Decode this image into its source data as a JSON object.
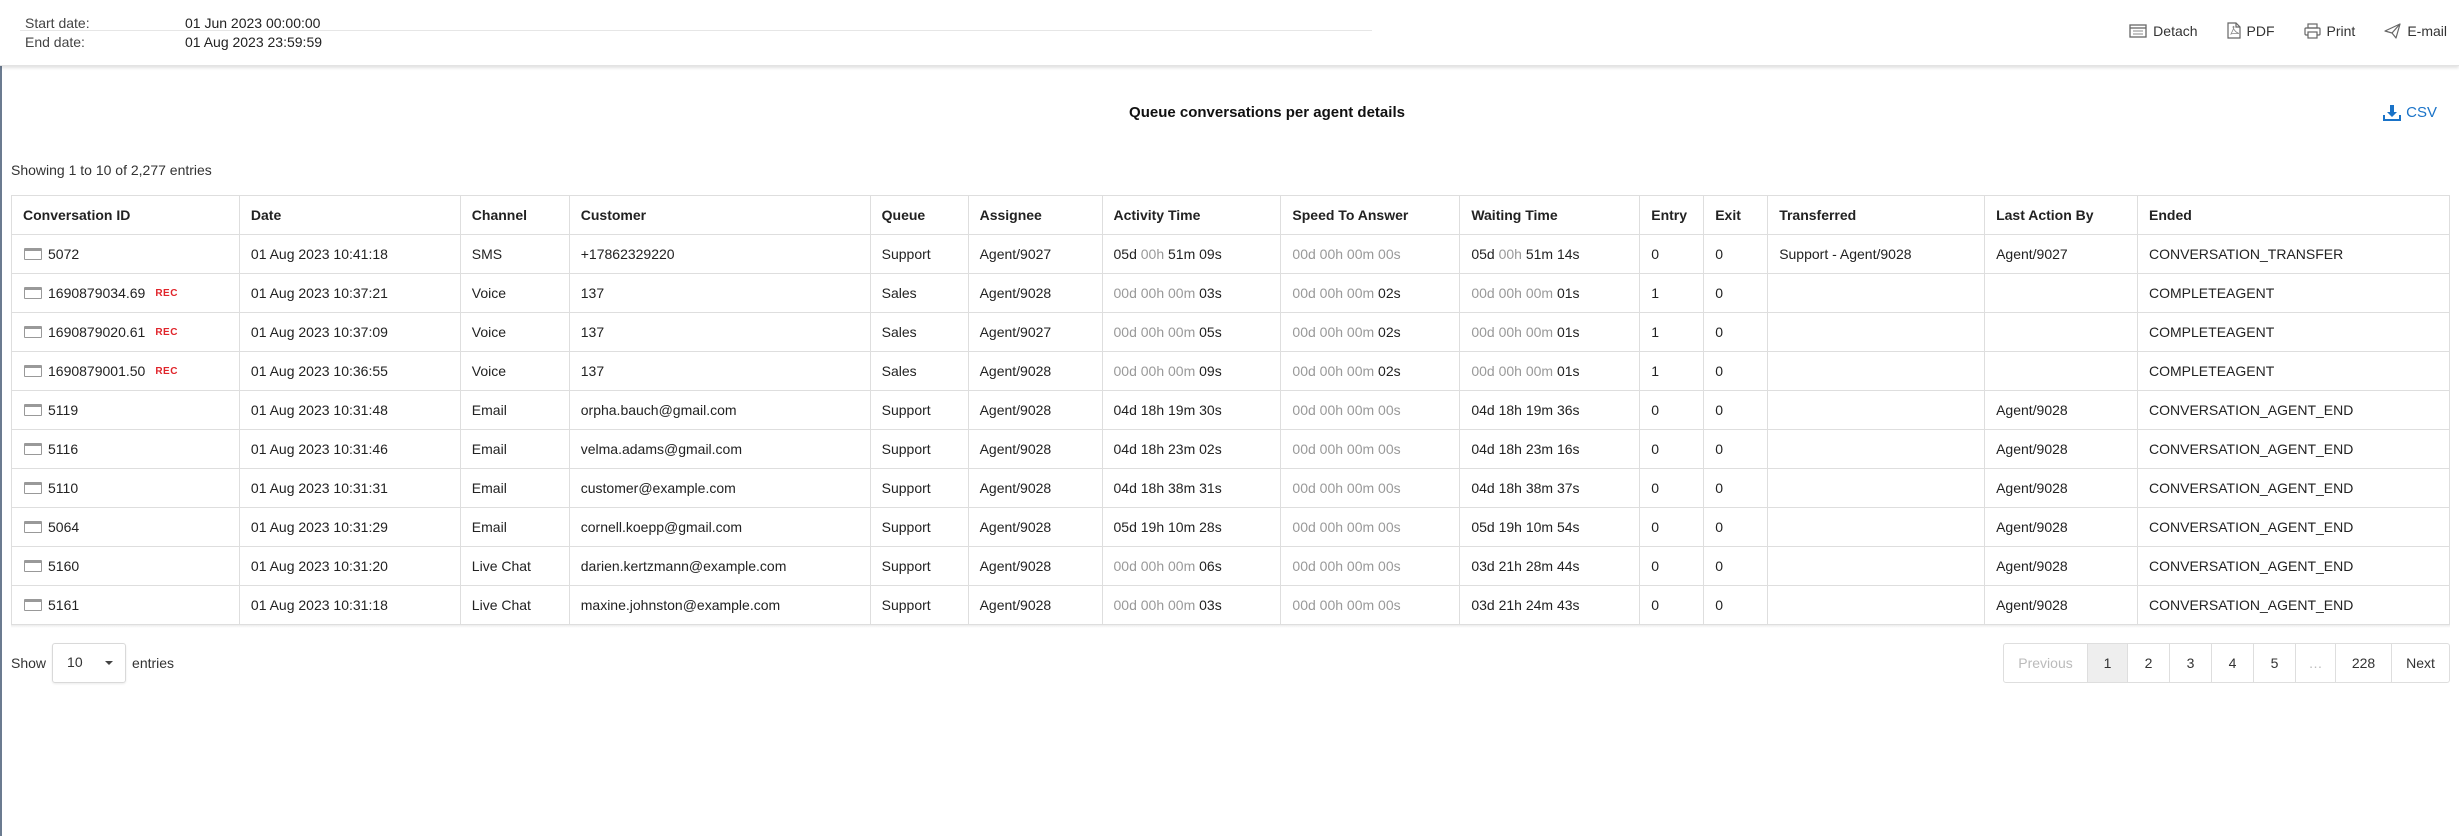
{
  "header": {
    "start_label": "Start date:",
    "start_value": "01 Jun 2023 00:00:00",
    "end_label": "End date:",
    "end_value": "01 Aug 2023 23:59:59"
  },
  "toolbar": {
    "detach": "Detach",
    "pdf": "PDF",
    "print": "Print",
    "email": "E-mail"
  },
  "report": {
    "title": "Queue conversations per agent details",
    "csv_label": "CSV",
    "showing": "Showing 1 to 10 of 2,277 entries"
  },
  "table": {
    "headers": [
      "Conversation ID",
      "Date",
      "Channel",
      "Customer",
      "Queue",
      "Assignee",
      "Activity Time",
      "Speed To Answer",
      "Waiting Time",
      "Entry",
      "Exit",
      "Transferred",
      "Last Action By",
      "Ended"
    ],
    "rows": [
      {
        "id": "5072",
        "rec": "",
        "date": "01 Aug 2023 10:41:18",
        "channel": "SMS",
        "customer": "+17862329220",
        "queue": "Support",
        "assignee": "Agent/9027",
        "activity": [
          {
            "t": "05d ",
            "d": false
          },
          {
            "t": "00h ",
            "d": true
          },
          {
            "t": "51m 09s",
            "d": false
          }
        ],
        "speed": [
          {
            "t": "00d 00h 00m 00s",
            "d": true
          }
        ],
        "waiting": [
          {
            "t": "05d ",
            "d": false
          },
          {
            "t": "00h ",
            "d": true
          },
          {
            "t": "51m 14s",
            "d": false
          }
        ],
        "entry": "0",
        "exit": "0",
        "transferred": "Support - Agent/9028",
        "last_action": "Agent/9027",
        "ended": "CONVERSATION_TRANSFER"
      },
      {
        "id": "1690879034.69",
        "rec": "REC",
        "date": "01 Aug 2023 10:37:21",
        "channel": "Voice",
        "customer": "137",
        "queue": "Sales",
        "assignee": "Agent/9028",
        "activity": [
          {
            "t": "00d 00h 00m ",
            "d": true
          },
          {
            "t": "03s",
            "d": false
          }
        ],
        "speed": [
          {
            "t": "00d 00h 00m ",
            "d": true
          },
          {
            "t": "02s",
            "d": false
          }
        ],
        "waiting": [
          {
            "t": "00d 00h 00m ",
            "d": true
          },
          {
            "t": "01s",
            "d": false
          }
        ],
        "entry": "1",
        "exit": "0",
        "transferred": "",
        "last_action": "",
        "ended": "COMPLETEAGENT"
      },
      {
        "id": "1690879020.61",
        "rec": "REC",
        "date": "01 Aug 2023 10:37:09",
        "channel": "Voice",
        "customer": "137",
        "queue": "Sales",
        "assignee": "Agent/9027",
        "activity": [
          {
            "t": "00d 00h 00m ",
            "d": true
          },
          {
            "t": "05s",
            "d": false
          }
        ],
        "speed": [
          {
            "t": "00d 00h 00m ",
            "d": true
          },
          {
            "t": "02s",
            "d": false
          }
        ],
        "waiting": [
          {
            "t": "00d 00h 00m ",
            "d": true
          },
          {
            "t": "01s",
            "d": false
          }
        ],
        "entry": "1",
        "exit": "0",
        "transferred": "",
        "last_action": "",
        "ended": "COMPLETEAGENT"
      },
      {
        "id": "1690879001.50",
        "rec": "REC",
        "date": "01 Aug 2023 10:36:55",
        "channel": "Voice",
        "customer": "137",
        "queue": "Sales",
        "assignee": "Agent/9028",
        "activity": [
          {
            "t": "00d 00h 00m ",
            "d": true
          },
          {
            "t": "09s",
            "d": false
          }
        ],
        "speed": [
          {
            "t": "00d 00h 00m ",
            "d": true
          },
          {
            "t": "02s",
            "d": false
          }
        ],
        "waiting": [
          {
            "t": "00d 00h 00m ",
            "d": true
          },
          {
            "t": "01s",
            "d": false
          }
        ],
        "entry": "1",
        "exit": "0",
        "transferred": "",
        "last_action": "",
        "ended": "COMPLETEAGENT"
      },
      {
        "id": "5119",
        "rec": "",
        "date": "01 Aug 2023 10:31:48",
        "channel": "Email",
        "customer": "orpha.bauch@gmail.com",
        "queue": "Support",
        "assignee": "Agent/9028",
        "activity": [
          {
            "t": "04d 18h 19m 30s",
            "d": false
          }
        ],
        "speed": [
          {
            "t": "00d 00h 00m 00s",
            "d": true
          }
        ],
        "waiting": [
          {
            "t": "04d 18h 19m 36s",
            "d": false
          }
        ],
        "entry": "0",
        "exit": "0",
        "transferred": "",
        "last_action": "Agent/9028",
        "ended": "CONVERSATION_AGENT_END"
      },
      {
        "id": "5116",
        "rec": "",
        "date": "01 Aug 2023 10:31:46",
        "channel": "Email",
        "customer": "velma.adams@gmail.com",
        "queue": "Support",
        "assignee": "Agent/9028",
        "activity": [
          {
            "t": "04d 18h 23m 02s",
            "d": false
          }
        ],
        "speed": [
          {
            "t": "00d 00h 00m 00s",
            "d": true
          }
        ],
        "waiting": [
          {
            "t": "04d 18h 23m 16s",
            "d": false
          }
        ],
        "entry": "0",
        "exit": "0",
        "transferred": "",
        "last_action": "Agent/9028",
        "ended": "CONVERSATION_AGENT_END"
      },
      {
        "id": "5110",
        "rec": "",
        "date": "01 Aug 2023 10:31:31",
        "channel": "Email",
        "customer": "customer@example.com",
        "queue": "Support",
        "assignee": "Agent/9028",
        "activity": [
          {
            "t": "04d 18h 38m 31s",
            "d": false
          }
        ],
        "speed": [
          {
            "t": "00d 00h 00m 00s",
            "d": true
          }
        ],
        "waiting": [
          {
            "t": "04d 18h 38m 37s",
            "d": false
          }
        ],
        "entry": "0",
        "exit": "0",
        "transferred": "",
        "last_action": "Agent/9028",
        "ended": "CONVERSATION_AGENT_END"
      },
      {
        "id": "5064",
        "rec": "",
        "date": "01 Aug 2023 10:31:29",
        "channel": "Email",
        "customer": "cornell.koepp@gmail.com",
        "queue": "Support",
        "assignee": "Agent/9028",
        "activity": [
          {
            "t": "05d 19h 10m 28s",
            "d": false
          }
        ],
        "speed": [
          {
            "t": "00d 00h 00m 00s",
            "d": true
          }
        ],
        "waiting": [
          {
            "t": "05d 19h 10m 54s",
            "d": false
          }
        ],
        "entry": "0",
        "exit": "0",
        "transferred": "",
        "last_action": "Agent/9028",
        "ended": "CONVERSATION_AGENT_END"
      },
      {
        "id": "5160",
        "rec": "",
        "date": "01 Aug 2023 10:31:20",
        "channel": "Live Chat",
        "customer": "darien.kertzmann@example.com",
        "queue": "Support",
        "assignee": "Agent/9028",
        "activity": [
          {
            "t": "00d 00h 00m ",
            "d": true
          },
          {
            "t": "06s",
            "d": false
          }
        ],
        "speed": [
          {
            "t": "00d 00h 00m 00s",
            "d": true
          }
        ],
        "waiting": [
          {
            "t": "03d 21h 28m 44s",
            "d": false
          }
        ],
        "entry": "0",
        "exit": "0",
        "transferred": "",
        "last_action": "Agent/9028",
        "ended": "CONVERSATION_AGENT_END"
      },
      {
        "id": "5161",
        "rec": "",
        "date": "01 Aug 2023 10:31:18",
        "channel": "Live Chat",
        "customer": "maxine.johnston@example.com",
        "queue": "Support",
        "assignee": "Agent/9028",
        "activity": [
          {
            "t": "00d 00h 00m ",
            "d": true
          },
          {
            "t": "03s",
            "d": false
          }
        ],
        "speed": [
          {
            "t": "00d 00h 00m 00s",
            "d": true
          }
        ],
        "waiting": [
          {
            "t": "03d 21h 24m 43s",
            "d": false
          }
        ],
        "entry": "0",
        "exit": "0",
        "transferred": "",
        "last_action": "Agent/9028",
        "ended": "CONVERSATION_AGENT_END"
      }
    ]
  },
  "footer": {
    "show_label": "Show",
    "page_size": "10",
    "entries_label": "entries",
    "pages": [
      {
        "label": "Previous",
        "state": "disabled"
      },
      {
        "label": "1",
        "state": "active"
      },
      {
        "label": "2",
        "state": ""
      },
      {
        "label": "3",
        "state": ""
      },
      {
        "label": "4",
        "state": ""
      },
      {
        "label": "5",
        "state": ""
      },
      {
        "label": "…",
        "state": "disabled"
      },
      {
        "label": "228",
        "state": ""
      },
      {
        "label": "Next",
        "state": ""
      }
    ]
  }
}
